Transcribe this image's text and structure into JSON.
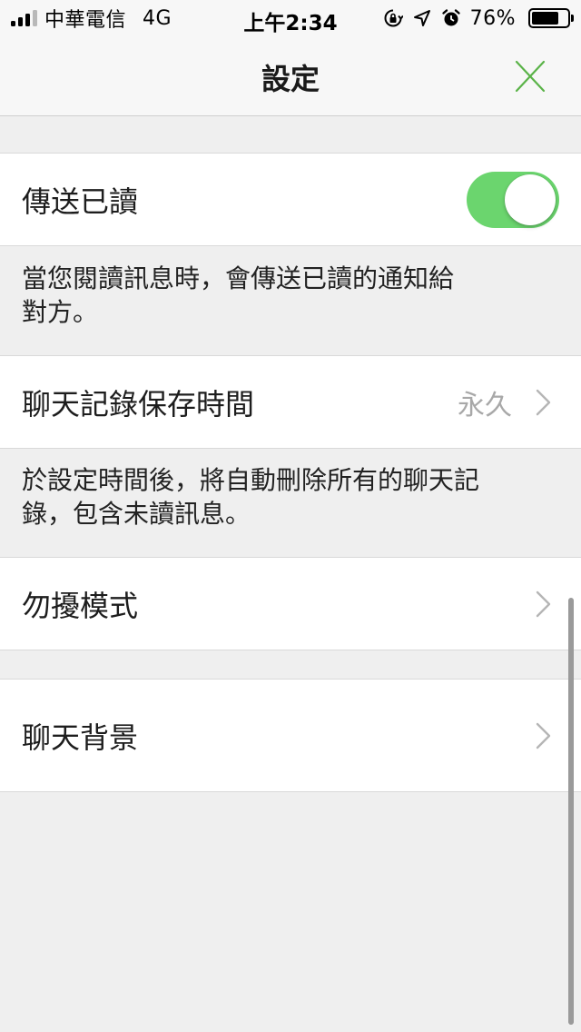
{
  "status_bar": {
    "carrier": "中華電信",
    "network": "4G",
    "time": "上午2:34",
    "battery": "76%",
    "battery_level": 0.76,
    "signal_bars_on": 3,
    "signal_bars_total": 4,
    "icons": [
      "orientation-lock-icon",
      "location-arrow-icon",
      "alarm-icon",
      "battery-icon"
    ]
  },
  "nav": {
    "title": "設定",
    "close_icon": "close-icon",
    "accent_color": "#5ab348"
  },
  "settings": {
    "read_receipt": {
      "label": "傳送已讀",
      "enabled": true,
      "toggle_color": "#6bd56e",
      "description_line1": "當您閱讀訊息時，會傳送已讀的通知給",
      "description_line2": "對方。"
    },
    "history_retention": {
      "label": "聊天記錄保存時間",
      "value": "永久",
      "description_line1": "於設定時間後，將自動刪除所有的聊天記",
      "description_line2": "錄，包含未讀訊息。"
    },
    "do_not_disturb": {
      "label": "勿擾模式"
    },
    "chat_background": {
      "label": "聊天背景"
    }
  }
}
